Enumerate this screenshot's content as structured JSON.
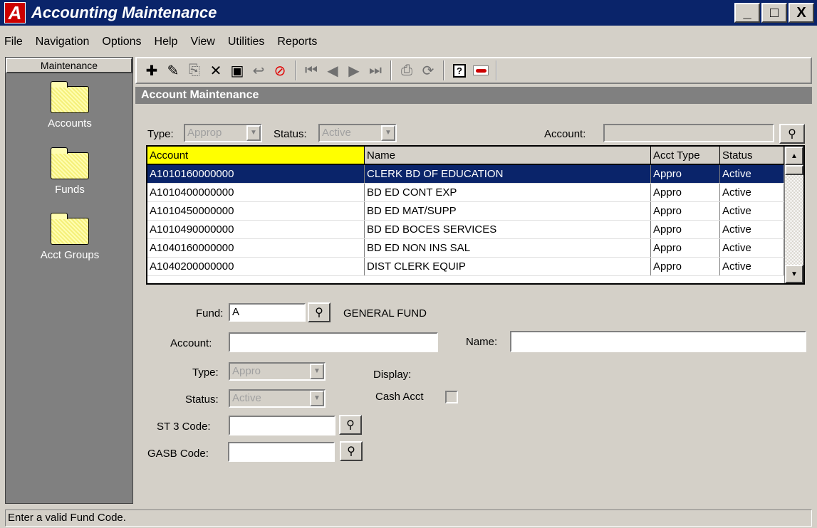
{
  "window": {
    "logo": "A",
    "title": "Accounting Maintenance",
    "minimize": "_",
    "maximize": "□",
    "close": "X"
  },
  "menu": [
    "File",
    "Navigation",
    "Options",
    "Help",
    "View",
    "Utilities",
    "Reports"
  ],
  "sidebar": {
    "header": "Maintenance",
    "items": [
      {
        "label": "Accounts",
        "icon": "folder-icon"
      },
      {
        "label": "Funds",
        "icon": "folder-icon"
      },
      {
        "label": "Acct Groups",
        "icon": "folder-icon"
      }
    ]
  },
  "toolbar": {
    "icons": [
      "add-icon",
      "edit-icon",
      "copy-icon",
      "delete-icon",
      "save-icon",
      "undo-icon",
      "cancel-icon",
      "first-record-icon",
      "previous-record-icon",
      "next-record-icon",
      "last-record-icon",
      "print-icon",
      "refresh-icon",
      "help-icon",
      "logo-icon"
    ]
  },
  "section": {
    "title": "Account Maintenance"
  },
  "filter": {
    "type_label": "Type:",
    "type_value": "Approp",
    "status_label": "Status:",
    "status_value": "Active",
    "account_label": "Account:",
    "account_value": ""
  },
  "grid": {
    "columns": [
      "Account",
      "Name",
      "Acct Type",
      "Status"
    ],
    "rows": [
      [
        "A1010160000000",
        "CLERK BD OF EDUCATION",
        "Appro",
        "Active"
      ],
      [
        "A1010400000000",
        "BD ED CONT EXP",
        "Appro",
        "Active"
      ],
      [
        "A1010450000000",
        "BD ED MAT/SUPP",
        "Appro",
        "Active"
      ],
      [
        "A1010490000000",
        "BD ED BOCES SERVICES",
        "Appro",
        "Active"
      ],
      [
        "A1040160000000",
        "BD ED  NON INS SAL",
        "Appro",
        "Active"
      ],
      [
        "A1040200000000",
        "DIST CLERK EQUIP",
        "Appro",
        "Active"
      ]
    ]
  },
  "form": {
    "fund_label": "Fund:",
    "fund_value": "A",
    "fund_name": "GENERAL FUND",
    "account_label": "Account:",
    "account_value": "",
    "name_label": "Name:",
    "name_value": "",
    "type_label": "Type:",
    "type_value": "Appro",
    "display_label": "Display:",
    "status_label": "Status:",
    "status_value": "Active",
    "cash_label": "Cash Acct",
    "st3_label": "ST 3 Code:",
    "st3_value": "",
    "gasb_label": "GASB Code:",
    "gasb_value": ""
  },
  "statusbar": {
    "message": "Enter a valid Fund Code."
  },
  "colors": {
    "title_bar": "#0a246a",
    "selection": "#0a246a",
    "sorted_header": "#ffff00",
    "logo_red": "#cc0000"
  }
}
